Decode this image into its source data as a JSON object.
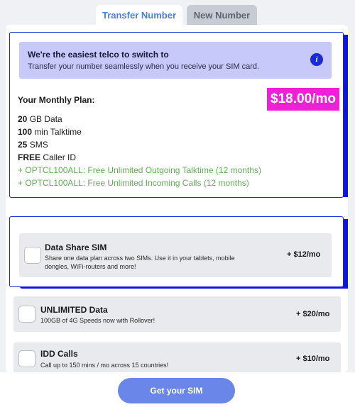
{
  "tabs": {
    "transfer": "Transfer Number",
    "new": "New Number"
  },
  "banner": {
    "title": "We're the easiest telco to switch to",
    "subtitle": "Transfer your number seamlessly when you receive your SIM card.",
    "icon": "info-icon"
  },
  "plan": {
    "label": "Your Monthly Plan:",
    "price": "$18.00/mo",
    "features": [
      {
        "value": "20",
        "unit": " GB Data"
      },
      {
        "value": "100",
        "unit": " min Talktime"
      },
      {
        "value": "25",
        "unit": " SMS"
      },
      {
        "value": "FREE",
        "unit": " Caller ID"
      }
    ],
    "promos": [
      "+ OPTCL100ALL: Free Unlimited Outgoing Talktime (12 months)",
      "+ OPTCL100ALL: Free Unlimited Incoming Calls (12 months)"
    ]
  },
  "addons": [
    {
      "title": "Data Share SIM",
      "desc_line1": "Share one data plan across two SIMs. Use it in your tablets, mobile",
      "desc_line2": "dongles, WiFi-routers and more!",
      "price": "+ $12/mo"
    },
    {
      "title": "UNLIMITED Data",
      "desc": "100GB of 4G Speeds now with Rollover!",
      "price": "+ $20/mo"
    },
    {
      "title": "IDD Calls",
      "desc": "Call up to 150 mins / mo across 15 countries!",
      "price": "+ $10/mo"
    }
  ],
  "cta": {
    "label": "Get your SIM"
  },
  "colors": {
    "accent_blue": "#1a2ad6",
    "price_magenta": "#ee21d6",
    "promo_green": "#5fb152",
    "cta_blue": "#6a86e8"
  }
}
